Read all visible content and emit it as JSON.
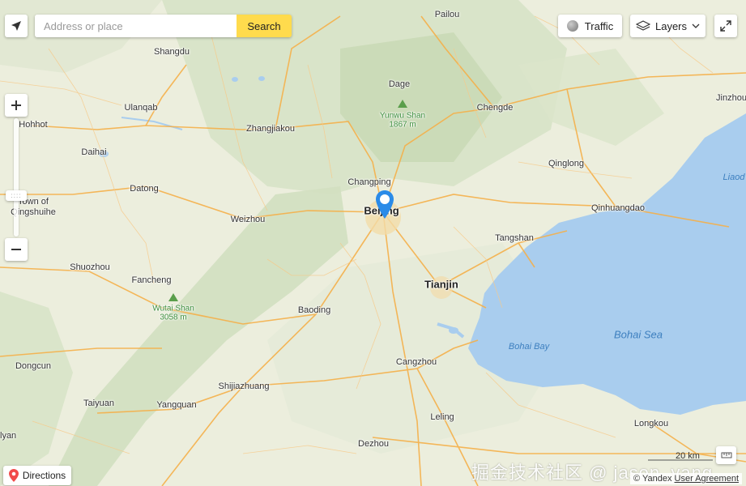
{
  "search": {
    "placeholder": "Address or place",
    "button_label": "Search"
  },
  "controls": {
    "traffic_label": "Traffic",
    "layers_label": "Layers",
    "directions_label": "Directions"
  },
  "attribution": {
    "copyright": "© Yandex",
    "link": "User Agreement"
  },
  "watermark": "掘金技术社区 @ jason_yang",
  "scale": {
    "label": "20 km"
  },
  "marker": {
    "city": "Beijing"
  },
  "places": {
    "pailou": "Pailou",
    "shangdu": "Shangdu",
    "dage": "Dage",
    "ulanqab": "Ulanqab",
    "chengde": "Chengde",
    "jinzhou": "Jinzhou",
    "hohhot": "Hohhot",
    "zhangjiakou": "Zhangjiakou",
    "daihai": "Daihai",
    "datong": "Datong",
    "changping": "Changping",
    "qinglong": "Qinglong",
    "town_qingshuihe_1": "Town of",
    "town_qingshuihe_2": "Qingshuihe",
    "weizhou": "Weizhou",
    "beijing": "Beijing",
    "qinhuangdao": "Qinhuangdao",
    "tangshan": "Tangshan",
    "shuozhou": "Shuozhou",
    "fancheng": "Fancheng",
    "tianjin": "Tianjin",
    "baoding": "Baoding",
    "dongcun": "Dongcun",
    "cangzhou": "Cangzhou",
    "shijiazhuang": "Shijiazhuang",
    "taiyuan": "Taiyuan",
    "yangquan": "Yangquan",
    "leling": "Leling",
    "longkou": "Longkou",
    "dezhou": "Dezhou",
    "lyan": "lyan",
    "liaod": "Liaod"
  },
  "peaks": {
    "yunwu_name": "Yunwu Shan",
    "yunwu_height": "1867 m",
    "wutai_name": "Wutai Shan",
    "wutai_height": "3058 m"
  },
  "water": {
    "bohai_sea": "Bohai Sea",
    "bohai_bay": "Bohai Bay"
  }
}
